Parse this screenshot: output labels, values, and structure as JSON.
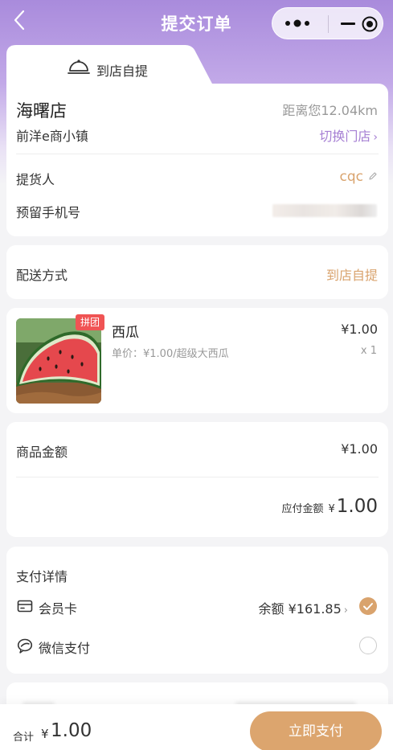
{
  "navbar": {
    "title": "提交订单"
  },
  "pickup": {
    "tab_label": "到店自提",
    "store_name": "海曙店",
    "distance": "距离您12.04km",
    "address": "前洋e商小镇",
    "switch_label": "切换门店",
    "pickup_person_label": "提货人",
    "pickup_person_value": "cqc",
    "phone_label": "预留手机号"
  },
  "delivery": {
    "label": "配送方式",
    "value": "到店自提"
  },
  "product": {
    "tag": "拼团",
    "name": "西瓜",
    "unit_price": "单价：¥1.00/超级大西瓜",
    "price": "¥1.00",
    "quantity": "x 1"
  },
  "amount": {
    "goods_label": "商品金额",
    "goods_value": "¥1.00",
    "payable_label": "应付金额",
    "payable_currency": "¥",
    "payable_value": "1.00"
  },
  "payment": {
    "title": "支付详情",
    "member_card_label": "会员卡",
    "balance": "余额 ¥161.85",
    "wechat_label": "微信支付",
    "selected": "member_card"
  },
  "bottom": {
    "total_label": "合计",
    "total_currency": "¥",
    "total_value": "1.00",
    "pay_button": "立即支付"
  },
  "colors": {
    "accent_purple": "#a67fd3",
    "accent_gold": "#d9a36d",
    "tag_red": "#f05454"
  }
}
